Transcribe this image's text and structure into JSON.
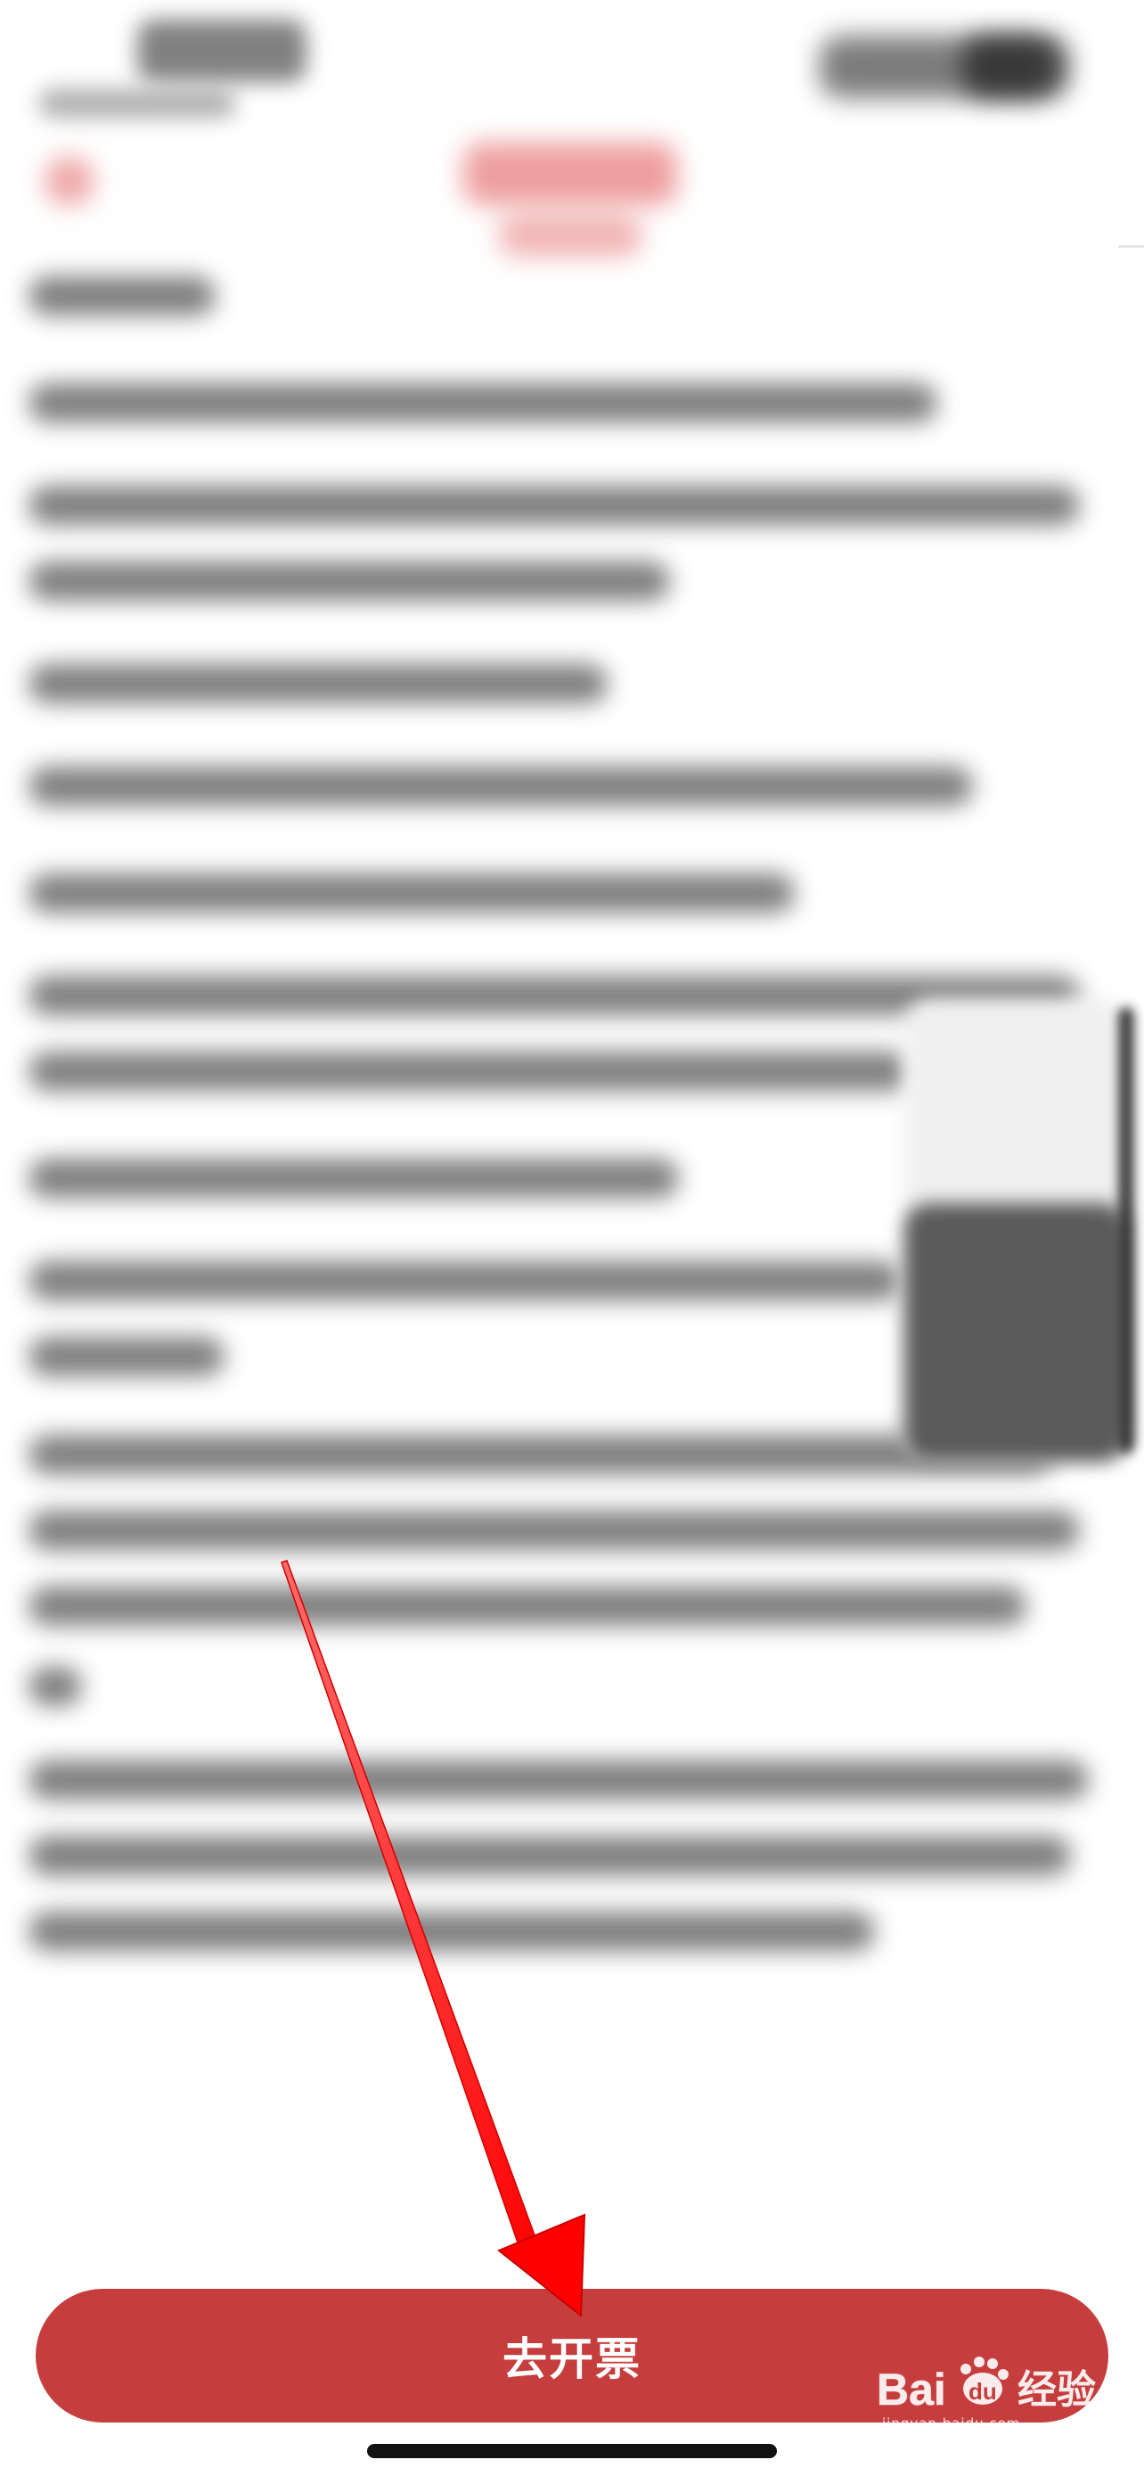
{
  "bottom_bar": {
    "button_label": "去开票"
  },
  "watermark": {
    "brand_text": "Bai du 经验",
    "sub_text": "jingyan.baidu.com"
  },
  "icons": {
    "back": "back-chevron-icon",
    "arrow": "red-arrow-annotation-icon",
    "watermark": "baidu-paw-logo-icon"
  },
  "colors": {
    "button_bg": "#c63d3d",
    "button_text": "#ffffff",
    "arrow": "#ff0000",
    "nav_accent": "#e05050"
  }
}
